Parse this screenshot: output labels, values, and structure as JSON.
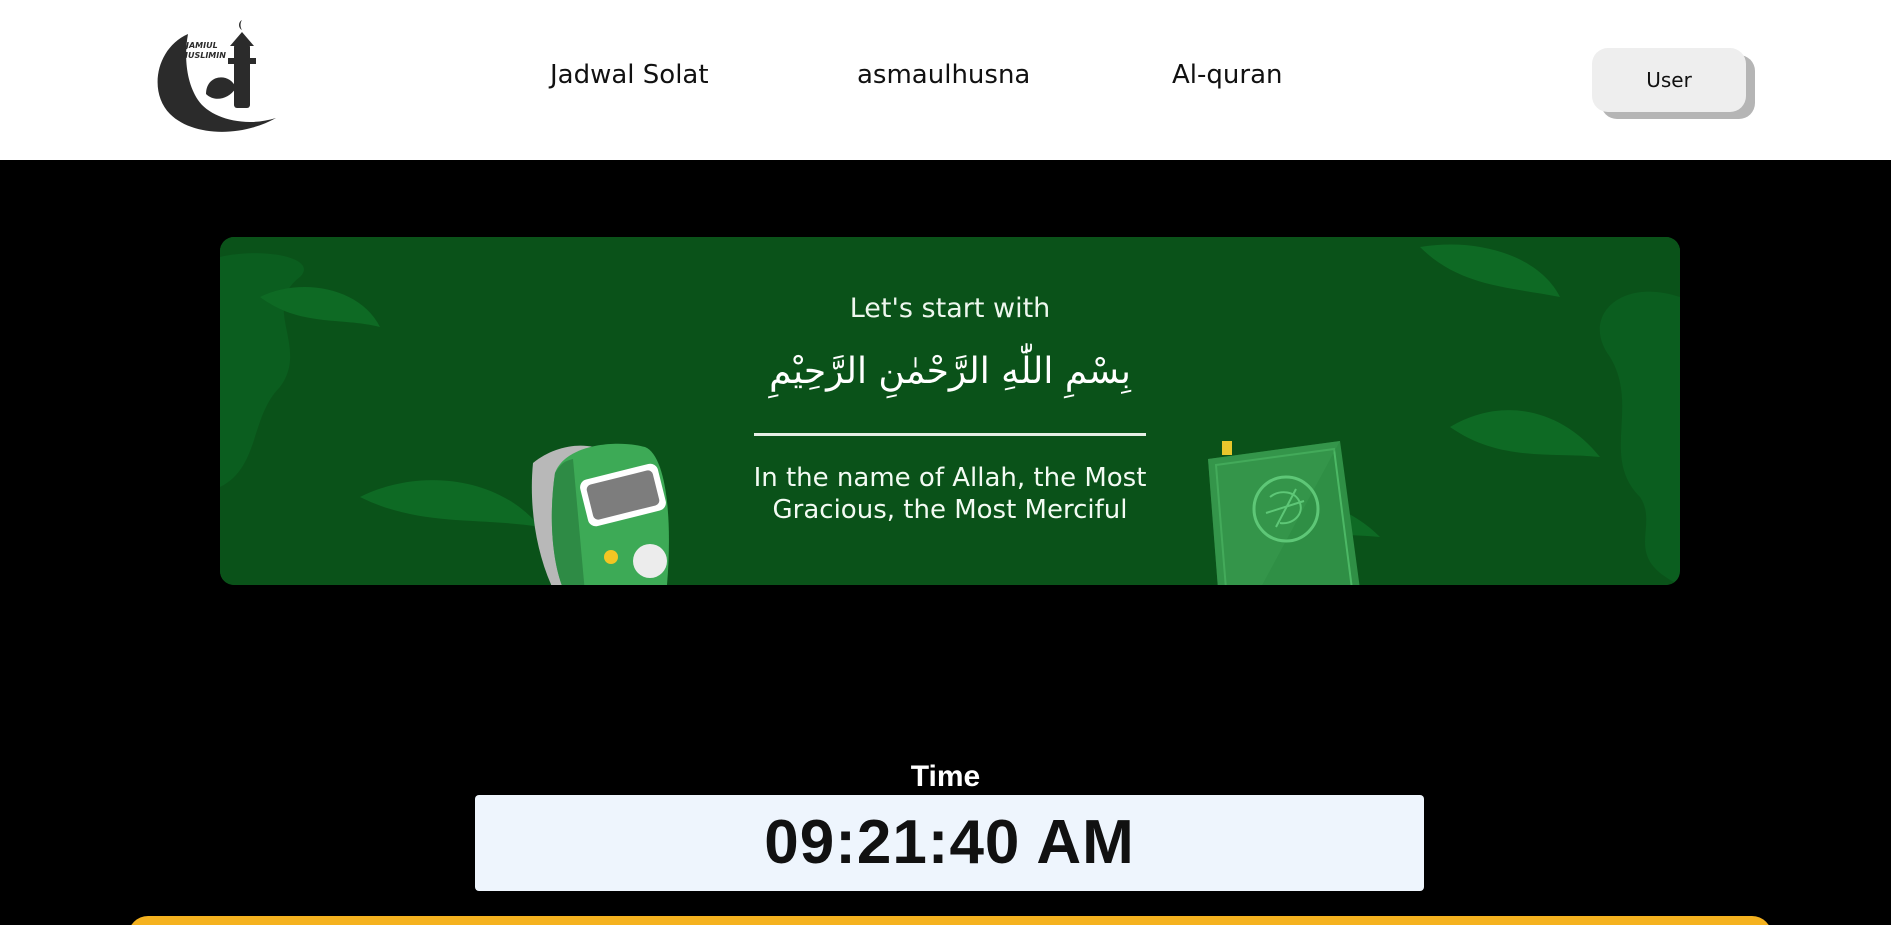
{
  "header": {
    "logo": {
      "name": "jamiul-muslimin-logo",
      "line1": "JAMIUL",
      "line2": "MUSLIMIN"
    },
    "nav": [
      {
        "label": "Jadwal Solat"
      },
      {
        "label": "asmaulhusna"
      },
      {
        "label": "Al-quran"
      }
    ],
    "user_button": "User"
  },
  "banner": {
    "intro": "Let's start with",
    "arabic": "بِسْمِ اللّٰهِ الرَّحْمٰنِ الرَّحِيْمِ",
    "translation": "In the name of Allah, the Most Gracious, the Most Merciful",
    "colors": {
      "background": "#0b5e1f",
      "foliage": "#0a5219"
    },
    "illustrations": [
      "tasbih-counter-icon",
      "quran-book-icon"
    ]
  },
  "time": {
    "label": "Time",
    "value": "09:21:40 AM"
  },
  "colors": {
    "page_background": "#000000",
    "header_background": "#ffffff",
    "time_box": "#eef5fd",
    "accent_bar": "#f5b21f"
  }
}
